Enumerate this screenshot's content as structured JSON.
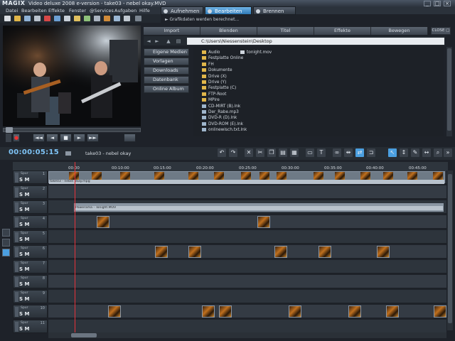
{
  "app": {
    "logo": "MAGIX",
    "title": "Video deluxe 2008 e-version - take03 - nebel okay.MVD"
  },
  "window_controls": [
    "_",
    "□",
    "×"
  ],
  "menu": [
    "Datei",
    "Bearbeiten",
    "Effekte",
    "Fenster",
    "@Services",
    "Aufgaben",
    "Hilfe"
  ],
  "modes": [
    {
      "label": "Aufnehmen",
      "active": false
    },
    {
      "label": "Bearbeiten",
      "active": true
    },
    {
      "label": "Brennen",
      "active": false
    }
  ],
  "status_line": "► Grafikdaten werden berechnet...",
  "transport": [
    "◄◄",
    "◄",
    "■",
    "►",
    "►►",
    "●"
  ],
  "media_pool": {
    "tabs": [
      "Import",
      "Blenden",
      "Titel",
      "Effekte",
      "Bewegen"
    ],
    "close_label": "CLOSE ▢",
    "path": "C:\\Users\\Niessenstein\\Desktop",
    "sidebar": [
      "Eigene Medien",
      "Vorlagen",
      "Downloads",
      "Datenbank",
      "Online Album"
    ],
    "files_col1": [
      "Audio",
      "Festplatte Online",
      "FH",
      "Dokumente",
      "Drive (X)",
      "Drive (Y)",
      "Festplatte (C)",
      "FTP-Root",
      "MPire",
      "CD-MIRT (B).lnk",
      "Der_Rabe.mp3",
      "DVD-R (D).lnk",
      "DVD-ROM (E).lnk",
      "onlinewisch.txt.lnk"
    ],
    "files_col2": [
      "tonight.mov"
    ]
  },
  "timeline": {
    "timecode": "00:00:05:15",
    "arrangement": "take03 - nebel okay",
    "ruler": [
      "00:00",
      "00:10:00",
      "00:15:00",
      "00:20:00",
      "00:25:00",
      "00:30:00",
      "00:35:00",
      "00:40:00",
      "00:45:00"
    ],
    "track_labels": [
      "Spur",
      "Spur",
      "Spur",
      "Spur",
      "Spur",
      "Spur",
      "Spur",
      "Spur",
      "Spur",
      "Spur",
      "Spur"
    ],
    "track_numbers": [
      "1",
      "2",
      "3",
      "4",
      "5",
      "6",
      "7",
      "8",
      "9",
      "10",
      "11"
    ],
    "solo": "S",
    "mute": "M",
    "clip_text_1": "take03 - nebel okay.mpg",
    "clip_text_2": "Powerama - Tonight.MOV"
  },
  "colors": {
    "accent": "#4b9fe0",
    "playhead": "#e8323a",
    "timecode": "#7ec3f5"
  }
}
